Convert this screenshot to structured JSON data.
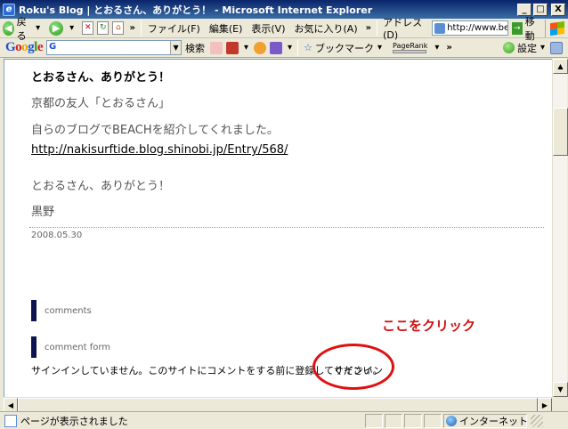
{
  "window": {
    "title": "Roku's Blog | とおるさん、ありがとう！ - Microsoft Internet Explorer",
    "buttons": {
      "minimize": "_",
      "maximize": "□",
      "close": "X"
    }
  },
  "toolbar": {
    "back_label": "戻る",
    "menus": [
      "ファイル(F)",
      "編集(E)",
      "表示(V)",
      "お気に入り(A)"
    ],
    "more": "»",
    "address_label": "アドレス(D)",
    "address_value": "http://www.beac",
    "go_label": "移動"
  },
  "google_toolbar": {
    "logo": [
      "G",
      "o",
      "o",
      "g",
      "l",
      "e"
    ],
    "search_prefix": "G",
    "search_label": "検索",
    "bookmarks_label": "ブックマーク",
    "pagerank_label": "PageRank",
    "more": "»",
    "settings_label": "設定"
  },
  "post": {
    "title": "とおるさん、ありがとう！",
    "line1": "京都の友人「とおるさん」",
    "line2": "自らのブログでBEACHを紹介してくれました。",
    "link": "http://nakisurftide.blog.shinobi.jp/Entry/568/",
    "line3": "とおるさん、ありがとう！",
    "signature": "黒野",
    "date": "2008.05.30"
  },
  "sections": {
    "comments": "comments",
    "comment_form": "comment form"
  },
  "signin": {
    "message": "サインインしていません。このサイトにコメントをする前に登録してください。",
    "link": "サインイン"
  },
  "annotation": {
    "text": "ここをクリック",
    "color": "#d01010"
  },
  "statusbar": {
    "text": "ページが表示されました",
    "zone": "インターネット"
  }
}
